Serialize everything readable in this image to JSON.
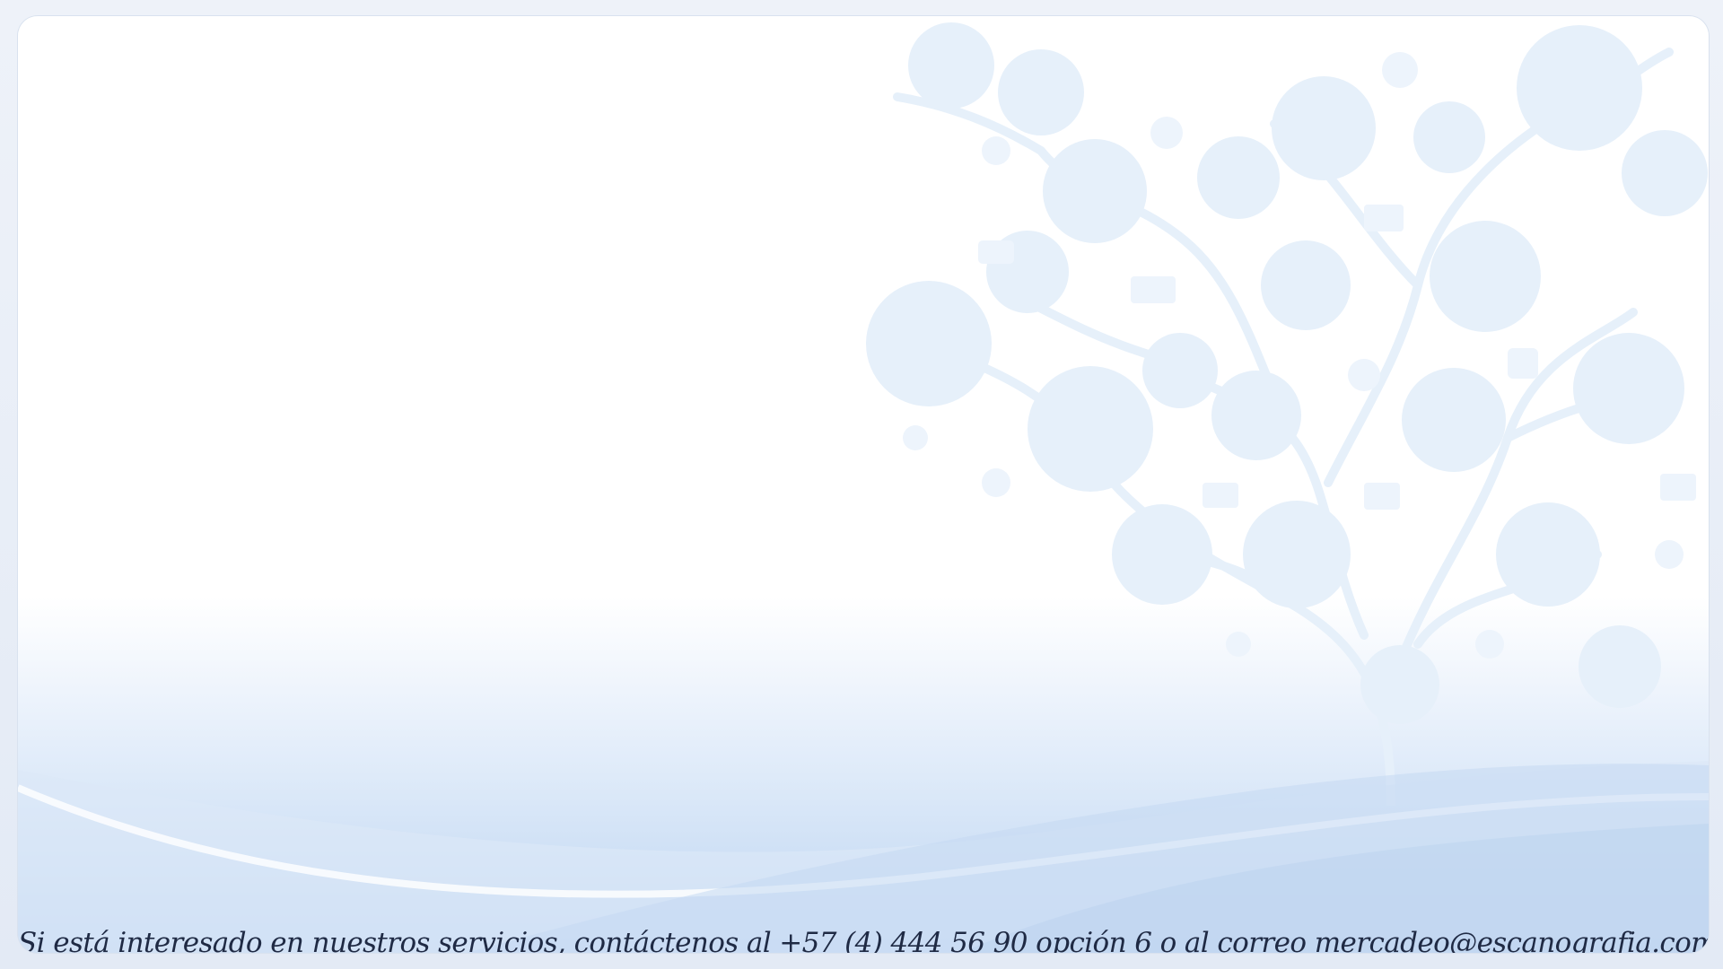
{
  "slide": {
    "contact_line": "Si está interesado en nuestros servicios, contáctenos al +57 (4) 444 56 90 opción 6 o al correo mercadeo@escanografia.com"
  },
  "decoration": {
    "background_theme": "social-media-icon-tree",
    "icons": [
      "star-icon",
      "share-icon",
      "mail-icon",
      "globe-icon",
      "eye-icon",
      "laptop-icon",
      "music-note-icon",
      "phone-call-icon",
      "at-sign-icon",
      "mobile-phone-icon",
      "gamepad-icon",
      "video-play-icon",
      "wifi-monitor-icon",
      "link-icon",
      "user-icon",
      "megaphone-icon",
      "home-icon",
      "touch-screen-icon",
      "chat-icon",
      "settings-gear-icon",
      "search-icon"
    ]
  },
  "colors": {
    "text": "#1f2a44",
    "accent_blue": "#bcd4f1",
    "pattern": "#e6f0fa"
  }
}
